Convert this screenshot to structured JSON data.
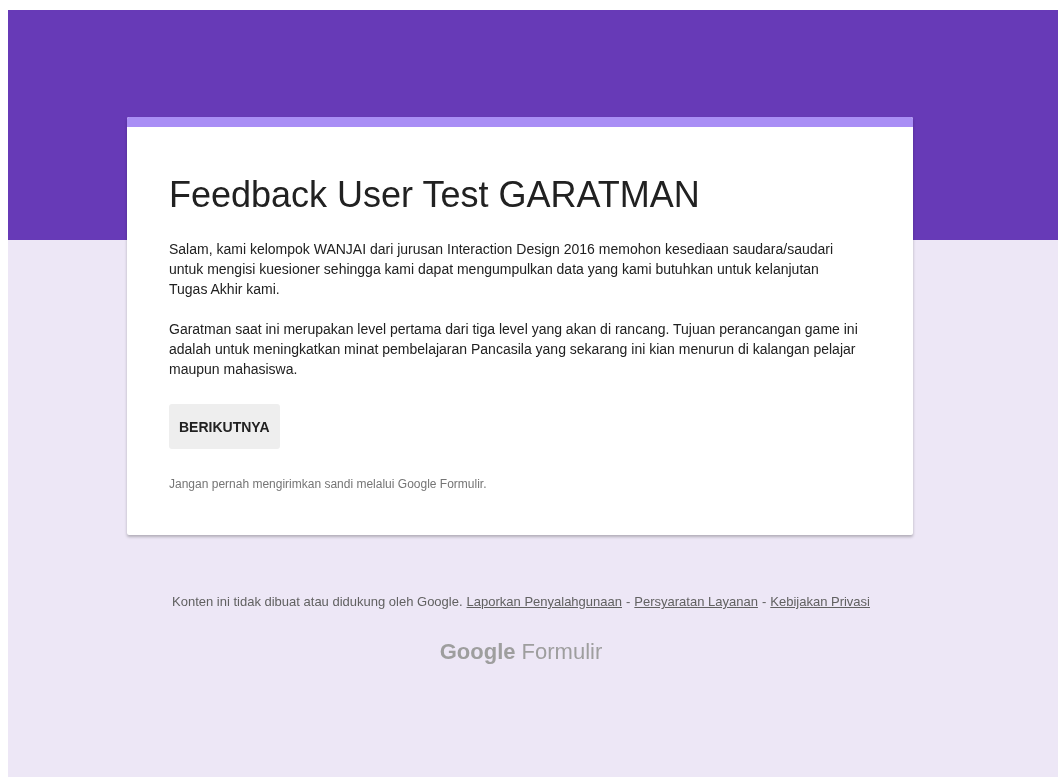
{
  "form": {
    "title": "Feedback User Test GARATMAN",
    "description": [
      "Salam, kami kelompok WANJAI dari jurusan Interaction Design 2016 memohon kesediaan saudara/saudari untuk mengisi kuesioner sehingga kami dapat mengumpulkan data yang kami butuhkan untuk kelanjutan Tugas Akhir kami.",
      "Garatman saat ini merupakan level pertama dari tiga level yang akan di rancang. Tujuan perancangan game ini adalah untuk meningkatkan minat pembelajaran Pancasila yang sekarang ini kian menurun di kalangan pelajar maupun mahasiswa."
    ],
    "next_button": "BERIKUTNYA",
    "warning": "Jangan pernah mengirimkan sandi melalui Google Formulir."
  },
  "footer": {
    "disclaimer": "Konten ini tidak dibuat atau didukung oleh Google.",
    "links": [
      "Laporkan Penyalahgunaan",
      "Persyaratan Layanan",
      "Kebijakan Privasi"
    ],
    "separator": "-",
    "logo": {
      "brand": "Google",
      "product": "Formulir"
    }
  }
}
